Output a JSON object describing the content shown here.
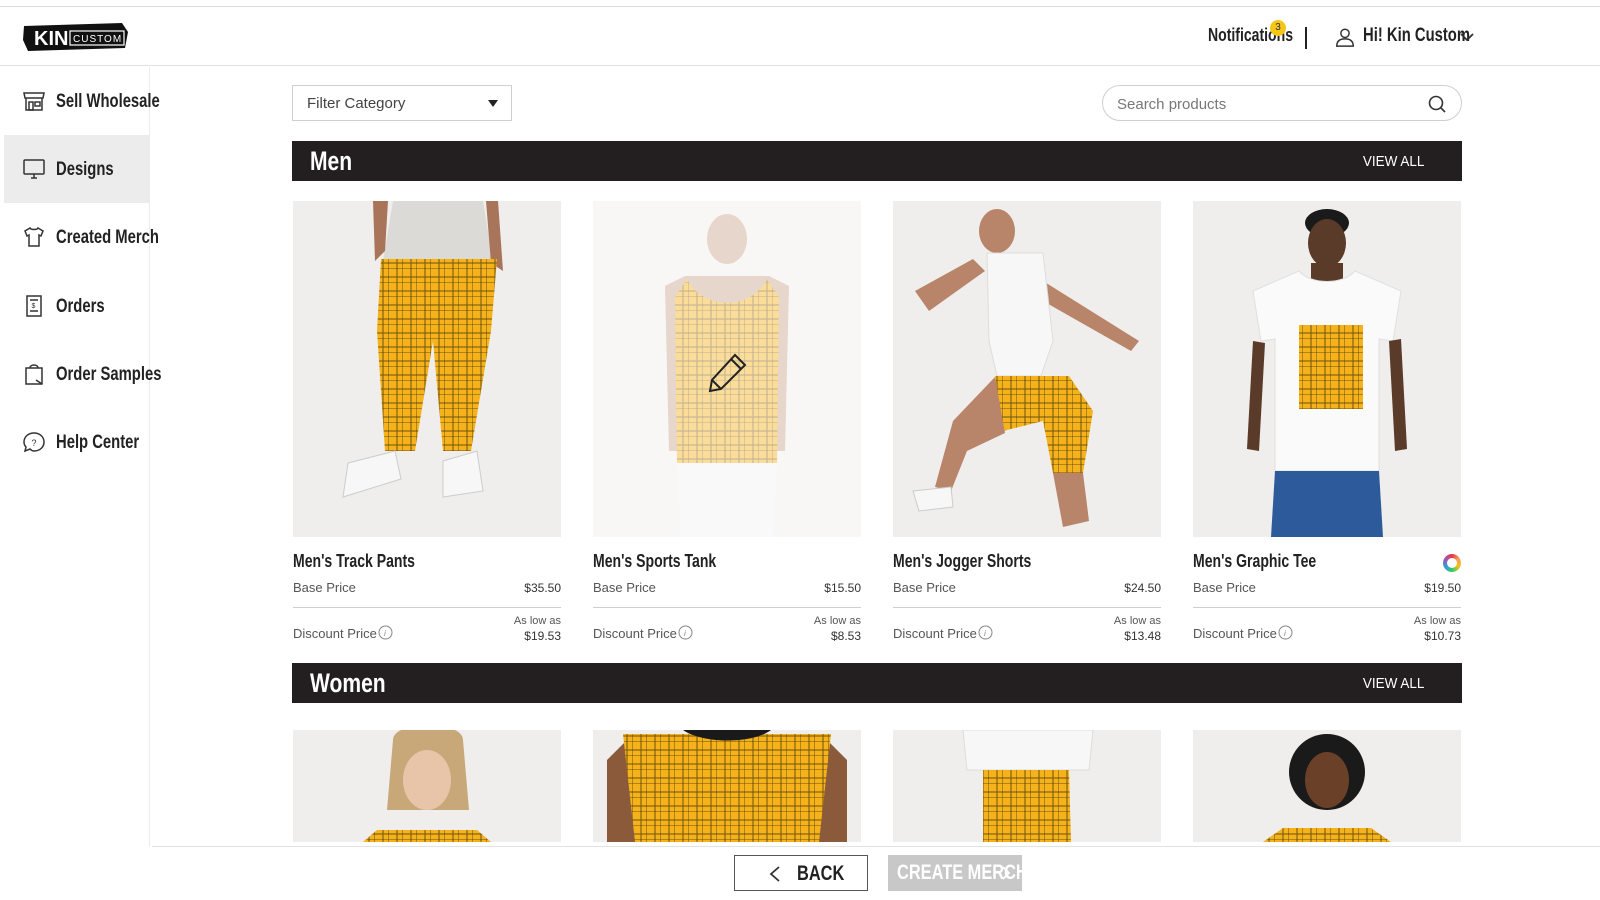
{
  "header": {
    "logo_main": "KIN",
    "logo_sub": "CUSTOM",
    "notifications_label": "Notifications",
    "notifications_count": "3",
    "user_greeting": "Hi! Kin Custom"
  },
  "sidebar": {
    "items": [
      {
        "label": "Sell Wholesale",
        "icon": "storefront-icon",
        "active": false
      },
      {
        "label": "Designs",
        "icon": "monitor-icon",
        "active": true
      },
      {
        "label": "Created Merch",
        "icon": "tshirt-icon",
        "active": false
      },
      {
        "label": "Orders",
        "icon": "receipt-icon",
        "active": false
      },
      {
        "label": "Order Samples",
        "icon": "shopping-bag-icon",
        "active": false
      },
      {
        "label": "Help Center",
        "icon": "help-chat-icon",
        "active": false
      }
    ]
  },
  "toolbar": {
    "filter_label": "Filter Category",
    "search_placeholder": "Search products"
  },
  "sections": {
    "men": {
      "title": "Men",
      "view_all": "VIEW ALL",
      "products": [
        {
          "name": "Men's Track Pants",
          "base_label": "Base Price",
          "base_price": "$35.50",
          "discount_label": "Discount Price",
          "as_low_as": "As low as",
          "discount_price": "$19.53"
        },
        {
          "name": "Men's Sports Tank",
          "base_label": "Base Price",
          "base_price": "$15.50",
          "discount_label": "Discount Price",
          "as_low_as": "As low as",
          "discount_price": "$8.53"
        },
        {
          "name": "Men's Jogger Shorts",
          "base_label": "Base Price",
          "base_price": "$24.50",
          "discount_label": "Discount Price",
          "as_low_as": "As low as",
          "discount_price": "$13.48"
        },
        {
          "name": "Men's Graphic Tee",
          "base_label": "Base Price",
          "base_price": "$19.50",
          "discount_label": "Discount Price",
          "as_low_as": "As low as",
          "discount_price": "$10.73"
        }
      ]
    },
    "women": {
      "title": "Women",
      "view_all": "VIEW ALL"
    }
  },
  "footer": {
    "back_label": "BACK",
    "create_label": "CREATE MERCH"
  },
  "colors": {
    "accent_yellow": "#f5b21b",
    "plaid_line": "#5a4a1a",
    "section_bar": "#231f20",
    "badge": "#f5c518"
  }
}
